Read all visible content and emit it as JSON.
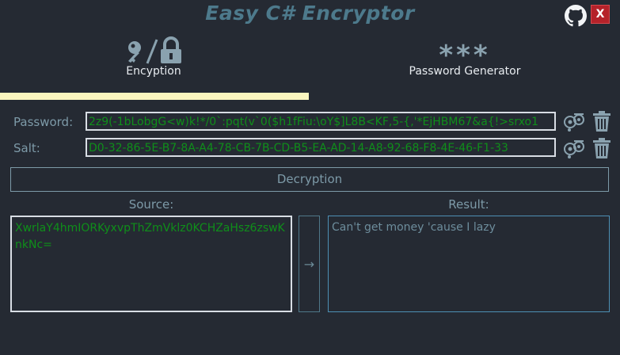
{
  "app": {
    "title": "Easy C# Encryptor",
    "close_label": "X",
    "github_icon": "github-icon"
  },
  "tabs": [
    {
      "label": "Encyption",
      "icon": "key-lock-icon",
      "active": true
    },
    {
      "label": "Password Generator",
      "icon": "asterisks-icon",
      "stars": "***",
      "active": false
    }
  ],
  "password": {
    "label": "Password:",
    "value": "2z9(-1bLobgG<w)k!*/0`:pqt(v`0($h1fFiu:\\oY$]L8B<KF,5-{,'*EjHBM67&a{!>srxo1"
  },
  "salt": {
    "label": "Salt:",
    "value": "D0-32-86-5E-B7-8A-A4-78-CB-7B-CD-B5-EA-AD-14-A8-92-68-F8-4E-46-F1-33"
  },
  "mode": {
    "label": "Decryption"
  },
  "source": {
    "label": "Source:",
    "value": "XwrlaY4hmIORKyxvpThZmVklz0KCHZaHsz6zswKnkNc="
  },
  "result": {
    "label": "Result:",
    "value": "Can't get money 'cause I lazy"
  },
  "process_button": {
    "label": "→"
  },
  "colors": {
    "background": "#252a33",
    "accent": "#4d7a8c",
    "field_text": "#0f8f1a",
    "tab_indicator": "#fbf6bf",
    "close": "#b5222a"
  }
}
